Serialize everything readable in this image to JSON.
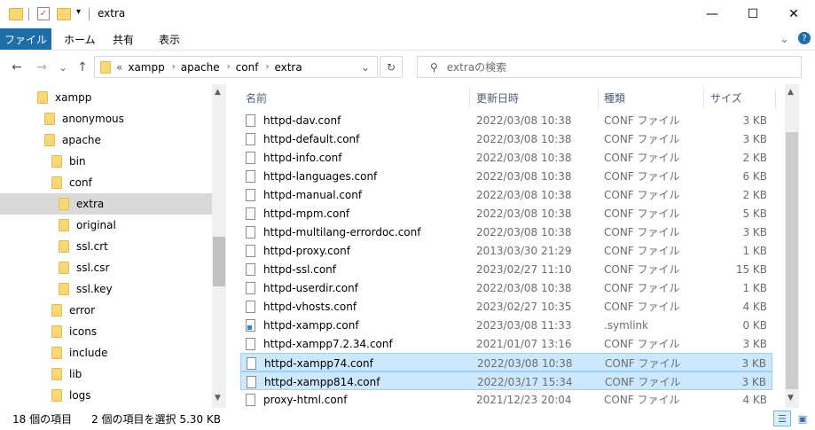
{
  "window": {
    "title": "extra"
  },
  "titlebar": {
    "minimize": "—",
    "maximize": "☐",
    "close": "✕"
  },
  "ribbon": {
    "file_tab": "ファイル",
    "tabs": [
      "ホーム",
      "共有",
      "表示"
    ],
    "expand": "⌄",
    "help": "?"
  },
  "nav": {
    "back": "←",
    "forward": "→",
    "recent": "⌄",
    "up": "↑",
    "breadcrumb_overflow": "«",
    "breadcrumb": [
      "xampp",
      "apache",
      "conf",
      "extra"
    ],
    "address_dropdown": "⌄",
    "refresh": "↻",
    "search_placeholder": "extraの検索"
  },
  "tree": [
    {
      "label": "xampp",
      "indent": 0,
      "selected": false
    },
    {
      "label": "anonymous",
      "indent": 1,
      "selected": false
    },
    {
      "label": "apache",
      "indent": 1,
      "selected": false
    },
    {
      "label": "bin",
      "indent": 2,
      "selected": false
    },
    {
      "label": "conf",
      "indent": 2,
      "selected": false
    },
    {
      "label": "extra",
      "indent": 3,
      "selected": true
    },
    {
      "label": "original",
      "indent": 3,
      "selected": false
    },
    {
      "label": "ssl.crt",
      "indent": 3,
      "selected": false
    },
    {
      "label": "ssl.csr",
      "indent": 3,
      "selected": false
    },
    {
      "label": "ssl.key",
      "indent": 3,
      "selected": false
    },
    {
      "label": "error",
      "indent": 2,
      "selected": false
    },
    {
      "label": "icons",
      "indent": 2,
      "selected": false
    },
    {
      "label": "include",
      "indent": 2,
      "selected": false
    },
    {
      "label": "lib",
      "indent": 2,
      "selected": false
    },
    {
      "label": "logs",
      "indent": 2,
      "selected": false
    }
  ],
  "columns": {
    "name": "名前",
    "date": "更新日時",
    "type": "種類",
    "size": "サイズ",
    "sort_indicator": "^"
  },
  "files": [
    {
      "name": "httpd-dav.conf",
      "date": "2022/03/08 10:38",
      "type": "CONF ファイル",
      "size": "3 KB",
      "selected": false,
      "link": false
    },
    {
      "name": "httpd-default.conf",
      "date": "2022/03/08 10:38",
      "type": "CONF ファイル",
      "size": "3 KB",
      "selected": false,
      "link": false
    },
    {
      "name": "httpd-info.conf",
      "date": "2022/03/08 10:38",
      "type": "CONF ファイル",
      "size": "2 KB",
      "selected": false,
      "link": false
    },
    {
      "name": "httpd-languages.conf",
      "date": "2022/03/08 10:38",
      "type": "CONF ファイル",
      "size": "6 KB",
      "selected": false,
      "link": false
    },
    {
      "name": "httpd-manual.conf",
      "date": "2022/03/08 10:38",
      "type": "CONF ファイル",
      "size": "2 KB",
      "selected": false,
      "link": false
    },
    {
      "name": "httpd-mpm.conf",
      "date": "2022/03/08 10:38",
      "type": "CONF ファイル",
      "size": "5 KB",
      "selected": false,
      "link": false
    },
    {
      "name": "httpd-multilang-errordoc.conf",
      "date": "2022/03/08 10:38",
      "type": "CONF ファイル",
      "size": "3 KB",
      "selected": false,
      "link": false
    },
    {
      "name": "httpd-proxy.conf",
      "date": "2013/03/30 21:29",
      "type": "CONF ファイル",
      "size": "1 KB",
      "selected": false,
      "link": false
    },
    {
      "name": "httpd-ssl.conf",
      "date": "2023/02/27 11:10",
      "type": "CONF ファイル",
      "size": "15 KB",
      "selected": false,
      "link": false
    },
    {
      "name": "httpd-userdir.conf",
      "date": "2022/03/08 10:38",
      "type": "CONF ファイル",
      "size": "1 KB",
      "selected": false,
      "link": false
    },
    {
      "name": "httpd-vhosts.conf",
      "date": "2023/02/27 10:35",
      "type": "CONF ファイル",
      "size": "4 KB",
      "selected": false,
      "link": false
    },
    {
      "name": "httpd-xampp.conf",
      "date": "2023/03/08 11:33",
      "type": ".symlink",
      "size": "0 KB",
      "selected": false,
      "link": true
    },
    {
      "name": "httpd-xampp7.2.34.conf",
      "date": "2021/01/07 13:16",
      "type": "CONF ファイル",
      "size": "3 KB",
      "selected": false,
      "link": false
    },
    {
      "name": "httpd-xampp74.conf",
      "date": "2022/03/08 10:38",
      "type": "CONF ファイル",
      "size": "3 KB",
      "selected": true,
      "link": false
    },
    {
      "name": "httpd-xampp814.conf",
      "date": "2022/03/17 15:34",
      "type": "CONF ファイル",
      "size": "3 KB",
      "selected": true,
      "link": false
    },
    {
      "name": "proxy-html.conf",
      "date": "2021/12/23 20:04",
      "type": "CONF ファイル",
      "size": "4 KB",
      "selected": false,
      "link": false
    }
  ],
  "scroll": {
    "up": "▲",
    "down": "▼"
  },
  "status": {
    "count": "18 個の項目",
    "selection": "2 個の項目を選択  5.30 KB"
  },
  "colors": {
    "accent": "#1e6fa8",
    "selection": "#cce8ff",
    "folder": "#f8d775"
  }
}
